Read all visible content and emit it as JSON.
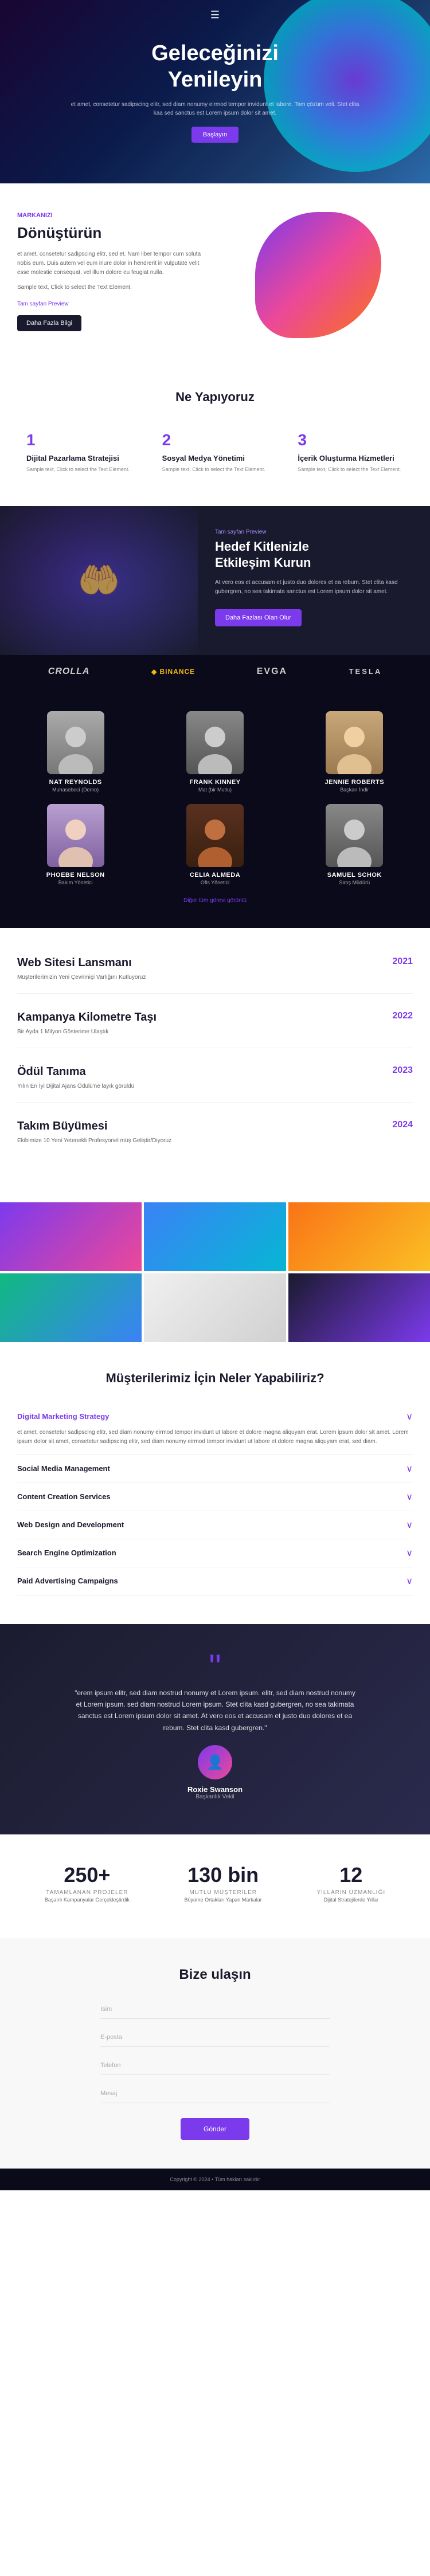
{
  "hero": {
    "title": "Geleceğinizi\nYenileyin",
    "subtitle": "et amet, consetetur sadipscing elitr, sed diam nonumy eirmod tempor invidunt et labore. Tam çözüm veli. Stet clita kaa sed sanctus est Lorem ipsum dolor sit amet.",
    "cta_button": "Başlayın",
    "menu_icon": "☰"
  },
  "transform": {
    "tag": "Markanızı",
    "title": "Dönüştürün",
    "text1": "et amet, consetetur sadipscing elitr, sed et. Nam liber tempor cum soluta nobis eum. Duis autem vel eum iriure dolor in hendrerit in vulputate velit esse molestie consequat, vel illum dolore eu feugiat nulla.",
    "text2": "Sample text, Click to select the Text Element.",
    "link": "Tam sayfan Preview",
    "button": "Daha Fazla Bilgi"
  },
  "services": {
    "title": "Ne Yapıyoruz",
    "items": [
      {
        "number": "1",
        "name": "Dijital Pazarlama Stratejisi",
        "desc": "Sample text, Click to select the Text Element."
      },
      {
        "number": "2",
        "name": "Sosyal Medya Yönetimi",
        "desc": "Sample text, Click to select the Text Element."
      },
      {
        "number": "3",
        "name": "İçerik Oluşturma Hizmetleri",
        "desc": "Sample text, Click to select the Text Element."
      }
    ]
  },
  "engage": {
    "tag": "Tam sayfan Preview",
    "title": "Hedef Kitlenizle\nEtkileşim Kurun",
    "text": "At vero eos et accusam et justo duo dolores et ea rebum. Stet clita kasd gubergren, no sea takimata sanctus est Lorem ipsum dolor sit amet.",
    "button": "Daha Fazlası Olan Olur"
  },
  "logos": {
    "items": [
      {
        "name": "CROLLA",
        "class": "crolla"
      },
      {
        "name": "◆ BINANCE",
        "class": "binance"
      },
      {
        "name": "EVGA",
        "class": "evga"
      },
      {
        "name": "TESLA",
        "class": "tesla"
      }
    ]
  },
  "team": {
    "members": [
      {
        "name": "NAT REYNOLDS",
        "role": "Muhasebeci (Demo)"
      },
      {
        "name": "FRANK KINNEY",
        "role": "Mat (bir Mutlu)"
      },
      {
        "name": "JENNIE ROBERTS",
        "role": "Başkan İndir"
      },
      {
        "name": "PHOEBE NELSON",
        "role": "Bakım Yönetici"
      },
      {
        "name": "CELIA ALMEDA",
        "role": "Ofis Yönetici"
      },
      {
        "name": "SAMUEL SCHOK",
        "role": "Satış Müdürü"
      }
    ],
    "more_link": "Diğer tüm görevi görüntü"
  },
  "timeline": {
    "items": [
      {
        "year": "2021",
        "title": "Web Sitesi Lansmanı",
        "text": "Müşterilerimizin Yeni Çevrimiçi Varlığını Kutluyoruz"
      },
      {
        "year": "2022",
        "title": "Kampanya Kilometre Taşı",
        "text": "Bir Ayda 1 Milyon Gösterime Ulaştık"
      },
      {
        "year": "2023",
        "title": "Ödül Tanıma",
        "text": "Yılın En İyi Dijital Ajans Ödülü'ne layık görüldü"
      },
      {
        "year": "2024",
        "title": "Takım Büyümesi",
        "text": "Ekibimize 10 Yeni Yetenekli Profesyonel müş Geliştir/Diyoruz"
      }
    ]
  },
  "accordion": {
    "title": "Müşterilerimiz İçin Neler Yapabiliriz?",
    "items": [
      {
        "label": "Digital Marketing Strategy",
        "label_class": "purple",
        "open": true,
        "body": "et amet, consetetur sadipscing elitr, sed diam nonumy eirmod tempor invidunt ut labore et dolore magna aliquyam erat. Lorem ipsum dolor sit amet. Lorem ipsum dolor sit amet, consetetur sadipscing elitr, sed diam nonumy eirmod tempor invidunt ut labore et dolore magna aliquyam erat, sed diam."
      },
      {
        "label": "Social Media Management",
        "label_class": "dark",
        "open": false,
        "body": ""
      },
      {
        "label": "Content Creation Services",
        "label_class": "dark",
        "open": false,
        "body": ""
      },
      {
        "label": "Web Design and Development",
        "label_class": "dark",
        "open": false,
        "body": ""
      },
      {
        "label": "Search Engine Optimization",
        "label_class": "dark",
        "open": false,
        "body": ""
      },
      {
        "label": "Paid Advertising Campaigns",
        "label_class": "dark",
        "open": false,
        "body": ""
      }
    ]
  },
  "testimonial": {
    "quote": "\"erem ipsum elitr, sed diam nostrud nonumy et Lorem ipsum. elitr, sed diam nostrud nonumy et Lorem ipsum. sed diam nostrud Lorem ipsum. Stet clita kasd gubergren, no sea takimata sanctus est Lorem ipsum dolor sit amet. At vero eos et accusam et justo duo dolores et ea rebum. Stet clita kasd gubergren.\"",
    "name": "Roxie Swanson",
    "role": "Başkanlık Vekil"
  },
  "stats": {
    "items": [
      {
        "number": "250+",
        "label": "TAMAMLANAN PROJELER",
        "sublabel": "Başarılı Kampanyalar Gerçekleştirdik"
      },
      {
        "number": "130 bin",
        "label": "MUTLU MÜŞTERİLER",
        "sublabel": "Büyüme Ortakları Yapan Markalar"
      },
      {
        "number": "12",
        "label": "YILLARIN UZMANLIĞI",
        "sublabel": "Dijital Stratejilerde Yıllar"
      }
    ]
  },
  "contact": {
    "title": "Bize ulaşın",
    "fields": [
      {
        "placeholder": "İsim",
        "type": "text",
        "name": "name-field"
      },
      {
        "placeholder": "E-posta",
        "type": "email",
        "name": "email-field"
      },
      {
        "placeholder": "Telefon",
        "type": "tel",
        "name": "phone-field"
      },
      {
        "placeholder": "Mesaj",
        "type": "text",
        "name": "message-field"
      }
    ],
    "submit_button": "Gönder",
    "submit_button_name": "submit-button"
  },
  "footer": {
    "text": "Copyright © 2024 • Tüm hakları saklıdır"
  }
}
